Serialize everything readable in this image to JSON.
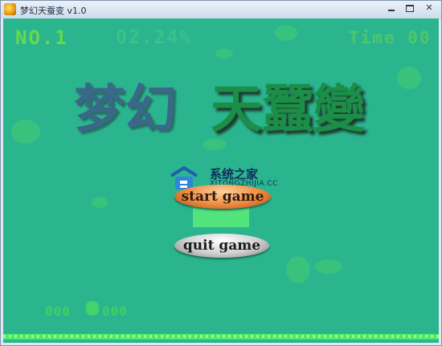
{
  "window": {
    "title": "梦幻天蚕变 v1.0"
  },
  "hud": {
    "level": "NO.1",
    "percent": "02.24%",
    "time": "Time 00"
  },
  "logo": {
    "part1": "梦幻",
    "part2": "天蠶變"
  },
  "watermark": {
    "main": "系统之家",
    "sub": "XITONGZHIJIA.CC"
  },
  "menu": {
    "start": "start game",
    "quit": "quit game"
  },
  "footer": {
    "lives_left": "000",
    "lives_right": "000"
  },
  "colors": {
    "background": "#2bb58f",
    "start_button": "#f08a3c",
    "quit_button": "#cfcfcf",
    "accent": "#52e37c"
  }
}
